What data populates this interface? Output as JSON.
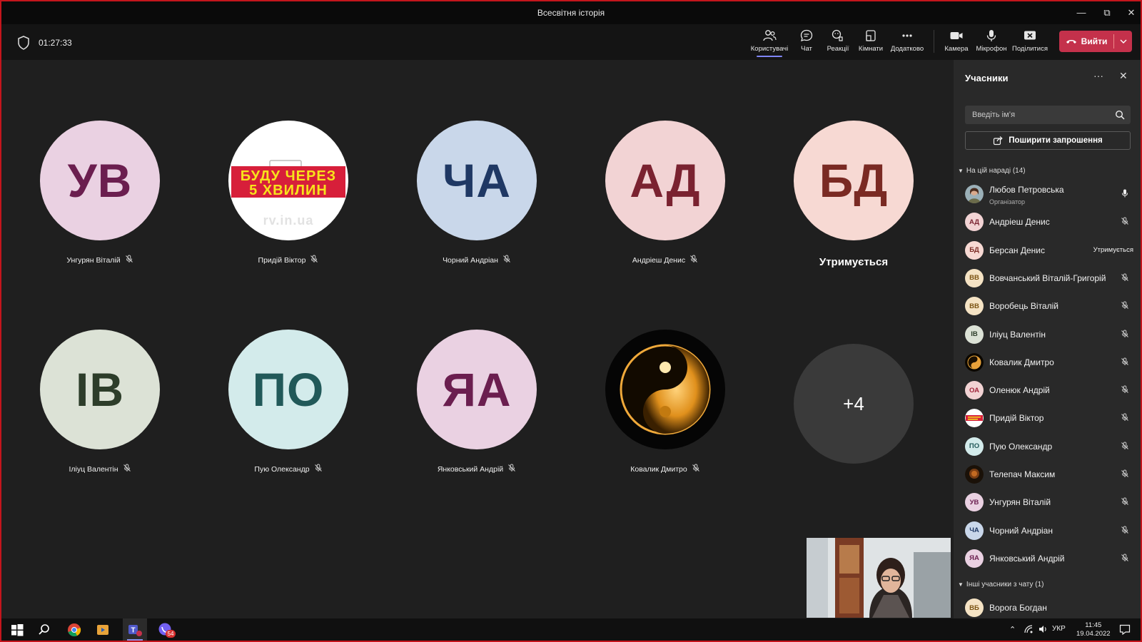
{
  "window": {
    "title": "Всесвітня історія",
    "controls": [
      "minimize-icon",
      "restore-icon",
      "close-icon"
    ]
  },
  "toolbar": {
    "timer": "01:27:33",
    "items": [
      {
        "label": "Користувачі",
        "icon": "people-icon",
        "active": true
      },
      {
        "label": "Чат",
        "icon": "chat-icon"
      },
      {
        "label": "Реакції",
        "icon": "reactions-icon"
      },
      {
        "label": "Кімнати",
        "icon": "rooms-icon"
      },
      {
        "label": "Додатково",
        "icon": "more-icon"
      },
      {
        "label": "Камера",
        "icon": "camera-icon"
      },
      {
        "label": "Мікрофон",
        "icon": "mic-icon"
      },
      {
        "label": "Поділитися",
        "icon": "share-screen-icon"
      }
    ],
    "leave_label": "Вийти"
  },
  "stage": {
    "tiles": [
      {
        "initials": "УВ",
        "name": "Унгурян Віталій",
        "bg": "#ead1e2",
        "fg": "#6b1e4f",
        "muted": true
      },
      {
        "name": "Придій Віктор",
        "image": "busy-sign",
        "sign_lines": [
          "БУДУ ЧЕРЕЗ",
          "5 ХВИЛИН"
        ],
        "watermark": "rv.in.ua",
        "muted": true
      },
      {
        "initials": "ЧА",
        "name": "Чорний Андріан",
        "bg": "#c9d7ea",
        "fg": "#1f3864",
        "muted": true
      },
      {
        "initials": "АД",
        "name": "Андріеш Денис",
        "bg": "#f2d3d4",
        "fg": "#7a2230",
        "muted": true
      },
      {
        "initials": "БД",
        "status": "Утримується",
        "bg": "#f7d9d3",
        "fg": "#7a2a23"
      },
      {
        "initials": "ІВ",
        "name": "Іліуц Валентін",
        "bg": "#dce2d6",
        "fg": "#2d3d2a",
        "muted": true
      },
      {
        "initials": "ПО",
        "name": "Пую Олександр",
        "bg": "#d3ebeb",
        "fg": "#215959",
        "muted": true
      },
      {
        "initials": "ЯА",
        "name": "Янковський Андрій",
        "bg": "#ead1e2",
        "fg": "#6b1e4f",
        "muted": true
      },
      {
        "name": "Ковалик Дмитро",
        "image": "yin-yang",
        "muted": true
      }
    ],
    "overflow": "+4"
  },
  "panel": {
    "title": "Учасники",
    "search_placeholder": "Введіть ім’я",
    "share_label": "Поширити запрошення",
    "section_in_meeting": "На цій нараді (14)",
    "section_others": "Інші учасники з чату (1)",
    "participants": [
      {
        "name": "Любов Петровська",
        "role": "Організатор",
        "avatar": "photo",
        "mic": "on"
      },
      {
        "name": "Андріеш Денис",
        "initials": "АД",
        "bg": "#f2d3d4",
        "fg": "#7a2230",
        "mic": "off"
      },
      {
        "name": "Берсан Денис",
        "initials": "БД",
        "bg": "#f7d9d3",
        "fg": "#7a2a23",
        "status": "Утримується"
      },
      {
        "name": "Вовчанський Віталій-Григорій",
        "initials": "ВВ",
        "bg": "#f5e3c4",
        "fg": "#7a5211",
        "mic": "off"
      },
      {
        "name": "Воробець Віталій",
        "initials": "ВВ",
        "bg": "#f5e3c4",
        "fg": "#7a5211",
        "mic": "off"
      },
      {
        "name": "Іліуц Валентін",
        "initials": "ІВ",
        "bg": "#dce2d6",
        "fg": "#2d3d2a",
        "mic": "off"
      },
      {
        "name": "Ковалик Дмитро",
        "avatar": "yin-yang",
        "mic": "off"
      },
      {
        "name": "Оленюк Андрій",
        "initials": "ОА",
        "bg": "#f2d3d4",
        "fg": "#a0243a",
        "mic": "off"
      },
      {
        "name": "Придій Віктор",
        "avatar": "busy-sign",
        "mic": "off"
      },
      {
        "name": "Пую Олександр",
        "initials": "ПО",
        "bg": "#d3ebeb",
        "fg": "#215959",
        "mic": "off"
      },
      {
        "name": "Телепач Максим",
        "avatar": "photo-dark",
        "mic": "off"
      },
      {
        "name": "Унгурян Віталій",
        "initials": "УВ",
        "bg": "#ead1e2",
        "fg": "#6b1e4f",
        "mic": "off"
      },
      {
        "name": "Чорний Андріан",
        "initials": "ЧА",
        "bg": "#c9d7ea",
        "fg": "#1f3864",
        "mic": "off"
      },
      {
        "name": "Янковський Андрій",
        "initials": "ЯА",
        "bg": "#ead1e2",
        "fg": "#6b1e4f",
        "mic": "off"
      }
    ],
    "others": [
      {
        "name": "Ворога Богдан",
        "initials": "ВБ",
        "bg": "#f5e3c4",
        "fg": "#7a5211"
      }
    ]
  },
  "taskbar": {
    "apps": [
      "windows-start-icon",
      "search-icon",
      "chrome-icon",
      "media-icon",
      "teams-icon",
      "viber-icon"
    ],
    "viber_badge": "54",
    "language": "УКР",
    "time": "11:45",
    "date": "19.04.2022"
  }
}
